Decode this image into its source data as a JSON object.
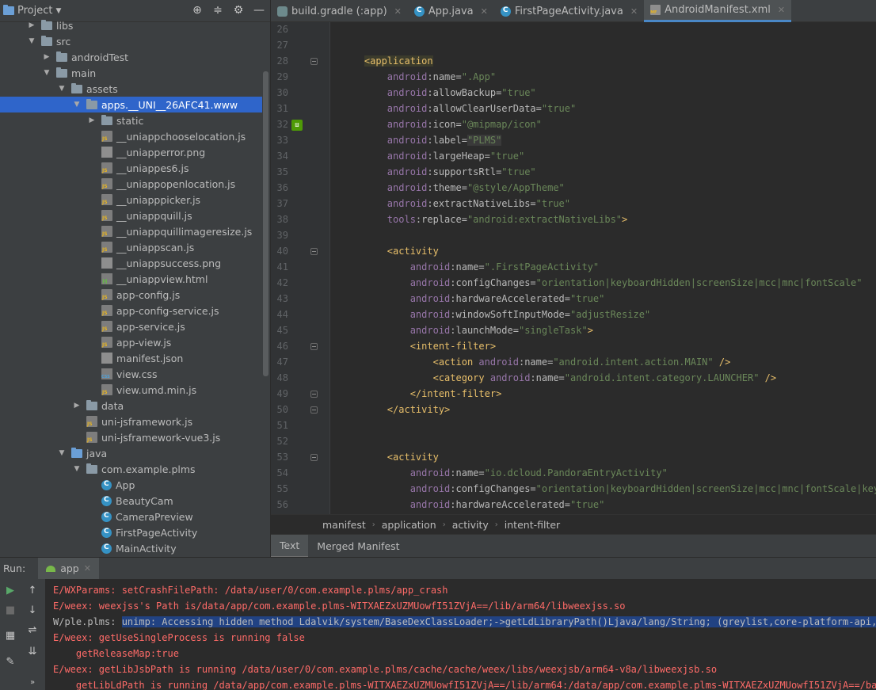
{
  "project_panel": {
    "title": "Project",
    "icons": [
      "target-icon",
      "collapse-all-icon",
      "gear-icon",
      "minimize-icon"
    ],
    "tree": [
      {
        "label": "libs",
        "indent": 0,
        "arrow": "right",
        "icon": "folder"
      },
      {
        "label": "src",
        "indent": 0,
        "arrow": "down",
        "icon": "folder"
      },
      {
        "label": "androidTest",
        "indent": 1,
        "arrow": "right",
        "icon": "folder"
      },
      {
        "label": "main",
        "indent": 1,
        "arrow": "down",
        "icon": "folder"
      },
      {
        "label": "assets",
        "indent": 2,
        "arrow": "down",
        "icon": "assets"
      },
      {
        "label": "apps.__UNI__26AFC41.www",
        "indent": 3,
        "arrow": "down",
        "icon": "folder",
        "selected": true
      },
      {
        "label": "static",
        "indent": 4,
        "arrow": "right",
        "icon": "folder"
      },
      {
        "label": "__uniappchooselocation.js",
        "indent": 4,
        "icon": "js"
      },
      {
        "label": "__uniapperror.png",
        "indent": 4,
        "icon": "img"
      },
      {
        "label": "__uniappes6.js",
        "indent": 4,
        "icon": "js"
      },
      {
        "label": "__uniappopenlocation.js",
        "indent": 4,
        "icon": "js"
      },
      {
        "label": "__uniapppicker.js",
        "indent": 4,
        "icon": "js"
      },
      {
        "label": "__uniappquill.js",
        "indent": 4,
        "icon": "js"
      },
      {
        "label": "__uniappquillimageresize.js",
        "indent": 4,
        "icon": "js"
      },
      {
        "label": "__uniappscan.js",
        "indent": 4,
        "icon": "js"
      },
      {
        "label": "__uniappsuccess.png",
        "indent": 4,
        "icon": "img"
      },
      {
        "label": "__uniappview.html",
        "indent": 4,
        "icon": "html"
      },
      {
        "label": "app-config.js",
        "indent": 4,
        "icon": "js"
      },
      {
        "label": "app-config-service.js",
        "indent": 4,
        "icon": "js"
      },
      {
        "label": "app-service.js",
        "indent": 4,
        "icon": "js"
      },
      {
        "label": "app-view.js",
        "indent": 4,
        "icon": "js"
      },
      {
        "label": "manifest.json",
        "indent": 4,
        "icon": "json"
      },
      {
        "label": "view.css",
        "indent": 4,
        "icon": "css"
      },
      {
        "label": "view.umd.min.js",
        "indent": 4,
        "icon": "js"
      },
      {
        "label": "data",
        "indent": 3,
        "arrow": "right",
        "icon": "folder"
      },
      {
        "label": "uni-jsframework.js",
        "indent": 3,
        "icon": "js"
      },
      {
        "label": "uni-jsframework-vue3.js",
        "indent": 3,
        "icon": "js"
      },
      {
        "label": "java",
        "indent": 2,
        "arrow": "down",
        "icon": "folder-blue"
      },
      {
        "label": "com.example.plms",
        "indent": 3,
        "arrow": "down",
        "icon": "package"
      },
      {
        "label": "App",
        "indent": 4,
        "icon": "class"
      },
      {
        "label": "BeautyCam",
        "indent": 4,
        "icon": "class"
      },
      {
        "label": "CameraPreview",
        "indent": 4,
        "icon": "class"
      },
      {
        "label": "FirstPageActivity",
        "indent": 4,
        "icon": "class"
      },
      {
        "label": "MainActivity",
        "indent": 4,
        "icon": "class"
      }
    ]
  },
  "editor_tabs": [
    {
      "label": "build.gradle (:app)",
      "icon": "gradle"
    },
    {
      "label": "App.java",
      "icon": "java"
    },
    {
      "label": "FirstPageActivity.java",
      "icon": "java"
    },
    {
      "label": "AndroidManifest.xml",
      "icon": "mf",
      "active": true
    }
  ],
  "code_lines": [
    {
      "n": "26",
      "spans": []
    },
    {
      "n": "27",
      "spans": []
    },
    {
      "n": "28",
      "fold": true,
      "spans": [
        [
          "plain",
          "    "
        ],
        [
          "tagh",
          "<application"
        ]
      ]
    },
    {
      "n": "29",
      "spans": [
        [
          "plain",
          "        "
        ],
        [
          "ns",
          "android"
        ],
        [
          "attr",
          ":name="
        ],
        [
          "val",
          "\".App\""
        ]
      ]
    },
    {
      "n": "30",
      "spans": [
        [
          "plain",
          "        "
        ],
        [
          "ns",
          "android"
        ],
        [
          "attr",
          ":allowBackup="
        ],
        [
          "val",
          "\"true\""
        ]
      ]
    },
    {
      "n": "31",
      "spans": [
        [
          "plain",
          "        "
        ],
        [
          "ns",
          "android"
        ],
        [
          "attr",
          ":allowClearUserData="
        ],
        [
          "val",
          "\"true\""
        ]
      ]
    },
    {
      "n": "32",
      "mark": true,
      "spans": [
        [
          "plain",
          "        "
        ],
        [
          "ns",
          "android"
        ],
        [
          "attr",
          ":icon="
        ],
        [
          "val",
          "\"@mipmap/icon\""
        ]
      ]
    },
    {
      "n": "33",
      "spans": [
        [
          "plain",
          "        "
        ],
        [
          "ns",
          "android"
        ],
        [
          "attr",
          ":label="
        ],
        [
          "valh",
          "\"PLMS\""
        ]
      ]
    },
    {
      "n": "34",
      "spans": [
        [
          "plain",
          "        "
        ],
        [
          "ns",
          "android"
        ],
        [
          "attr",
          ":largeHeap="
        ],
        [
          "val",
          "\"true\""
        ]
      ]
    },
    {
      "n": "35",
      "spans": [
        [
          "plain",
          "        "
        ],
        [
          "ns",
          "android"
        ],
        [
          "attr",
          ":supportsRtl="
        ],
        [
          "val",
          "\"true\""
        ]
      ]
    },
    {
      "n": "36",
      "spans": [
        [
          "plain",
          "        "
        ],
        [
          "ns",
          "android"
        ],
        [
          "attr",
          ":theme="
        ],
        [
          "val",
          "\"@style/AppTheme\""
        ]
      ]
    },
    {
      "n": "37",
      "spans": [
        [
          "plain",
          "        "
        ],
        [
          "ns",
          "android"
        ],
        [
          "attr",
          ":extractNativeLibs="
        ],
        [
          "val",
          "\"true\""
        ]
      ]
    },
    {
      "n": "38",
      "spans": [
        [
          "plain",
          "        "
        ],
        [
          "ns",
          "tools"
        ],
        [
          "attr",
          ":replace="
        ],
        [
          "val",
          "\"android:extractNativeLibs\""
        ],
        [
          "tag",
          ">"
        ]
      ]
    },
    {
      "n": "39",
      "spans": []
    },
    {
      "n": "40",
      "fold": true,
      "spans": [
        [
          "plain",
          "        "
        ],
        [
          "tag",
          "<activity"
        ]
      ]
    },
    {
      "n": "41",
      "spans": [
        [
          "plain",
          "            "
        ],
        [
          "ns",
          "android"
        ],
        [
          "attr",
          ":name="
        ],
        [
          "val",
          "\".FirstPageActivity\""
        ]
      ]
    },
    {
      "n": "42",
      "spans": [
        [
          "plain",
          "            "
        ],
        [
          "ns",
          "android"
        ],
        [
          "attr",
          ":configChanges="
        ],
        [
          "val",
          "\"orientation|keyboardHidden|screenSize|mcc|mnc|fontScale\""
        ]
      ]
    },
    {
      "n": "43",
      "spans": [
        [
          "plain",
          "            "
        ],
        [
          "ns",
          "android"
        ],
        [
          "attr",
          ":hardwareAccelerated="
        ],
        [
          "val",
          "\"true\""
        ]
      ]
    },
    {
      "n": "44",
      "spans": [
        [
          "plain",
          "            "
        ],
        [
          "ns",
          "android"
        ],
        [
          "attr",
          ":windowSoftInputMode="
        ],
        [
          "val",
          "\"adjustResize\""
        ]
      ]
    },
    {
      "n": "45",
      "spans": [
        [
          "plain",
          "            "
        ],
        [
          "ns",
          "android"
        ],
        [
          "attr",
          ":launchMode="
        ],
        [
          "val",
          "\"singleTask\""
        ],
        [
          "tag",
          ">"
        ]
      ]
    },
    {
      "n": "46",
      "fold": true,
      "spans": [
        [
          "plain",
          "            "
        ],
        [
          "tag",
          "<intent-filter>"
        ]
      ]
    },
    {
      "n": "47",
      "spans": [
        [
          "plain",
          "                "
        ],
        [
          "tag",
          "<action "
        ],
        [
          "ns",
          "android"
        ],
        [
          "attr",
          ":name="
        ],
        [
          "val",
          "\"android.intent.action.MAIN\""
        ],
        [
          "tag",
          " />"
        ]
      ]
    },
    {
      "n": "48",
      "spans": [
        [
          "plain",
          "                "
        ],
        [
          "tag",
          "<category "
        ],
        [
          "ns",
          "android"
        ],
        [
          "attr",
          ":name="
        ],
        [
          "val",
          "\"android.intent.category.LAUNCHER\""
        ],
        [
          "tag",
          " />"
        ]
      ]
    },
    {
      "n": "49",
      "fold": true,
      "spans": [
        [
          "plain",
          "            "
        ],
        [
          "tag",
          "</intent-filter>"
        ]
      ]
    },
    {
      "n": "50",
      "fold": true,
      "spans": [
        [
          "plain",
          "        "
        ],
        [
          "tag",
          "</activity>"
        ]
      ]
    },
    {
      "n": "51",
      "spans": []
    },
    {
      "n": "52",
      "spans": []
    },
    {
      "n": "53",
      "fold": true,
      "spans": [
        [
          "plain",
          "        "
        ],
        [
          "tag",
          "<activity"
        ]
      ]
    },
    {
      "n": "54",
      "spans": [
        [
          "plain",
          "            "
        ],
        [
          "ns",
          "android"
        ],
        [
          "attr",
          ":name="
        ],
        [
          "val",
          "\"io.dcloud.PandoraEntryActivity\""
        ]
      ]
    },
    {
      "n": "55",
      "spans": [
        [
          "plain",
          "            "
        ],
        [
          "ns",
          "android"
        ],
        [
          "attr",
          ":configChanges="
        ],
        [
          "val",
          "\"orientation|keyboardHidden|screenSize|mcc|mnc|fontScale|keyboard\""
        ]
      ]
    },
    {
      "n": "56",
      "spans": [
        [
          "plain",
          "            "
        ],
        [
          "ns",
          "android"
        ],
        [
          "attr",
          ":hardwareAccelerated="
        ],
        [
          "val",
          "\"true\""
        ]
      ]
    }
  ],
  "breadcrumb": [
    "manifest",
    "application",
    "activity",
    "intent-filter"
  ],
  "manifest_tabs": [
    {
      "label": "Text",
      "active": true
    },
    {
      "label": "Merged Manifest"
    }
  ],
  "run": {
    "label": "Run:",
    "tab": "app",
    "tool_icons": [
      "play-icon",
      "stop-icon",
      "layout-icon",
      "pin-icon",
      "up-arrow-icon",
      "down-arrow-icon",
      "soft-wrap-icon",
      "scroll-end-icon",
      "more-icon"
    ],
    "logs": [
      {
        "type": "err",
        "text": "E/WXParams: setCrashFilePath: /data/user/0/com.example.plms/app_crash"
      },
      {
        "type": "err",
        "text": "E/weex: weexjss's Path is/data/app/com.example.plms-WITXAEZxUZMUowfI51ZVjA==/lib/arm64/libweexjss.so"
      },
      {
        "type": "warn",
        "prefix": "W/ple.plms: ",
        "hl": "unimp: Accessing hidden method Ldalvik/system/BaseDexClassLoader;->getLdLibraryPath()Ljava/lang/String; (greylist,core-platform-api, refle"
      },
      {
        "type": "err",
        "text": "E/weex: getUseSingleProcess is running false"
      },
      {
        "type": "err",
        "text": "    getReleaseMap:true"
      },
      {
        "type": "err",
        "text": "E/weex: getLibJsbPath is running /data/user/0/com.example.plms/cache/cache/weex/libs/weexjsb/arm64-v8a/libweexjsb.so"
      },
      {
        "type": "err",
        "text": "    getLibLdPath is running /data/app/com.example.plms-WITXAEZxUZMUowfI51ZVjA==/lib/arm64:/data/app/com.example.plms-WITXAEZxUZMUowfI51ZVjA==/base.ap"
      }
    ]
  }
}
